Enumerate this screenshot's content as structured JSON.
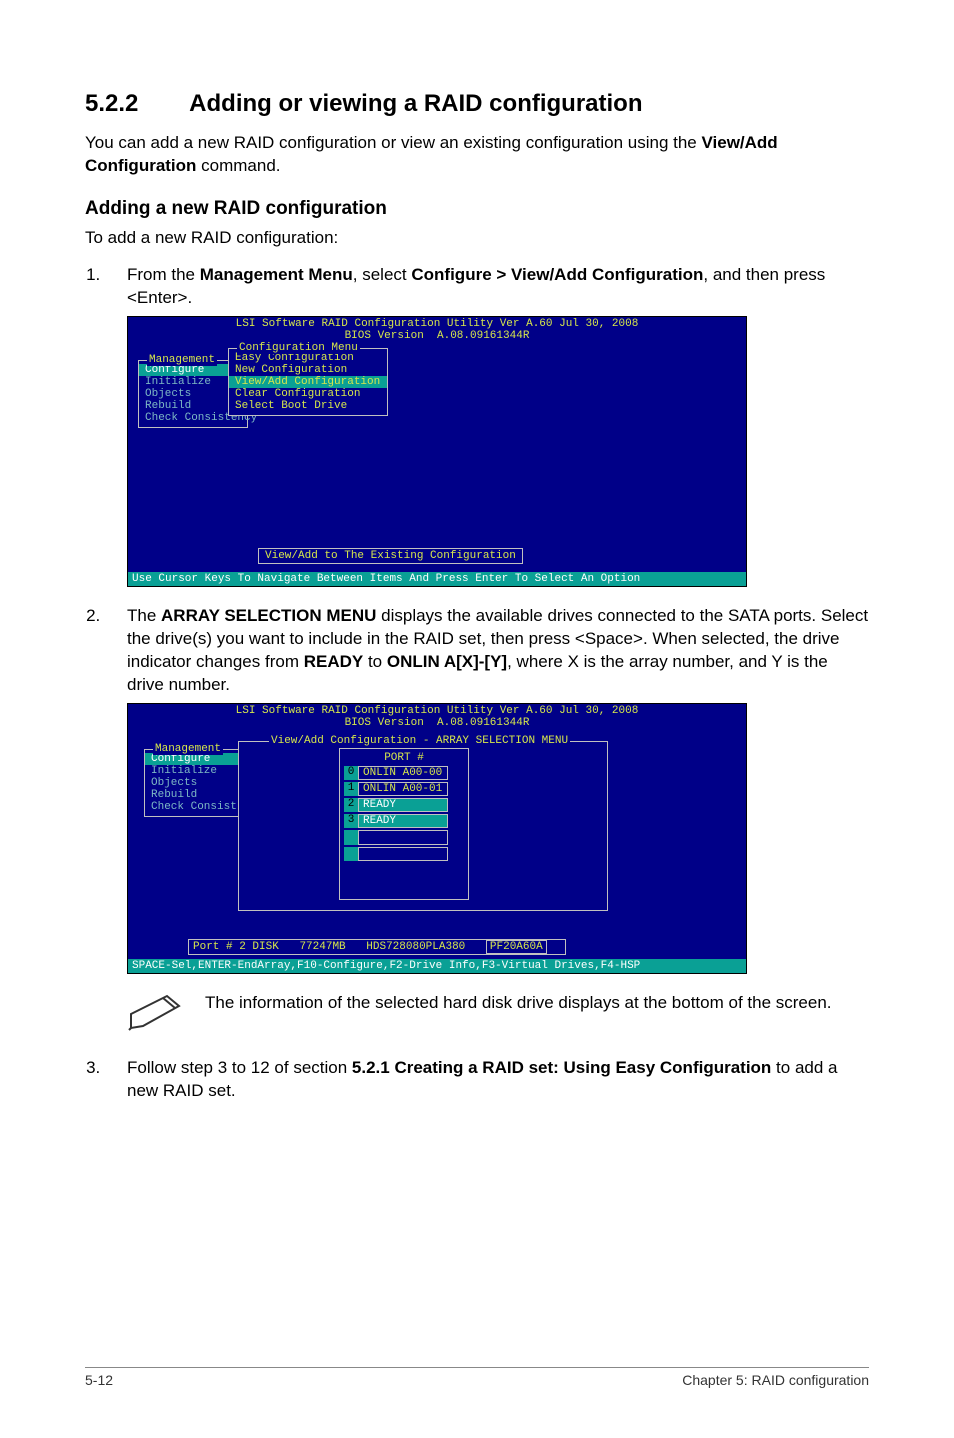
{
  "section": {
    "number": "5.2.2",
    "title": "Adding or viewing a RAID configuration"
  },
  "intro_text": "You can add a new RAID configuration or view an existing configuration using the ",
  "intro_bold": "View/Add Configuration",
  "intro_tail": " command.",
  "subheading": "Adding a new RAID configuration",
  "leadline": "To add a new RAID configuration:",
  "step1": {
    "pre": "From the ",
    "b1": "Management Menu",
    "mid": ", select ",
    "b2": "Configure > View/Add Configuration",
    "tail": ", and then press <Enter>."
  },
  "step2": {
    "pre": "The ",
    "b1": "ARRAY SELECTION MENU",
    "mid1": " displays the available drives connected to the SATA ports. Select the drive(s) you want to include in the RAID set, then press <Space>. When selected, the drive indicator changes from ",
    "b2": "READY",
    "mid2": " to ",
    "b3": "ONLIN A[X]-[Y]",
    "tail": ", where X is the array number, and Y is the drive number."
  },
  "note_text": "The information of the selected hard disk drive displays at the bottom of the screen.",
  "step3": {
    "pre": "Follow step 3 to 12 of section ",
    "b1": "5.2.1 Creating a RAID set: Using Easy Configuration",
    "tail": " to add a new RAID set."
  },
  "bios": {
    "title1": "LSI Software RAID Configuration Utility Ver A.60 Jul 30, 2008",
    "title2a": "BIOS Version",
    "title2b": "A.08.09161344R",
    "mgmt_label": "Management",
    "mgmt_items": [
      "Configure",
      "Initialize",
      "Objects",
      "Rebuild",
      "Check Consistency"
    ],
    "cfg_label": "Configuration Menu",
    "cfg_items": [
      "Easy Configuration",
      "New Configuration",
      "View/Add Configuration",
      "Clear Configuration",
      "Select Boot Drive"
    ],
    "status1": "View/Add to The Existing Configuration",
    "footer1": "Use Cursor Keys To Navigate Between Items And Press Enter To Select An Option"
  },
  "bios2": {
    "mgmt_items": [
      "Configure",
      "Initialize",
      "Objects",
      "Rebuild",
      "Check Consist"
    ],
    "array_label": "View/Add Configuration - ARRAY SELECTION MENU",
    "port_header": "PORT #",
    "ports": [
      {
        "idx": "0",
        "val": "ONLIN A00-00",
        "green": false
      },
      {
        "idx": "1",
        "val": "ONLIN A00-01",
        "green": false
      },
      {
        "idx": "2",
        "val": "READY",
        "green": true
      },
      {
        "idx": "3",
        "val": "READY",
        "green": true
      }
    ],
    "disk_label": "Port # 2 DISK",
    "disk_size": "77247MB",
    "disk_model": "HDS728080PLA380",
    "disk_fw": "PF20A60A",
    "footer2": "SPACE-Sel,ENTER-EndArray,F10-Configure,F2-Drive Info,F3-Virtual Drives,F4-HSP"
  },
  "footer": {
    "left": "5-12",
    "right": "Chapter 5: RAID configuration"
  }
}
